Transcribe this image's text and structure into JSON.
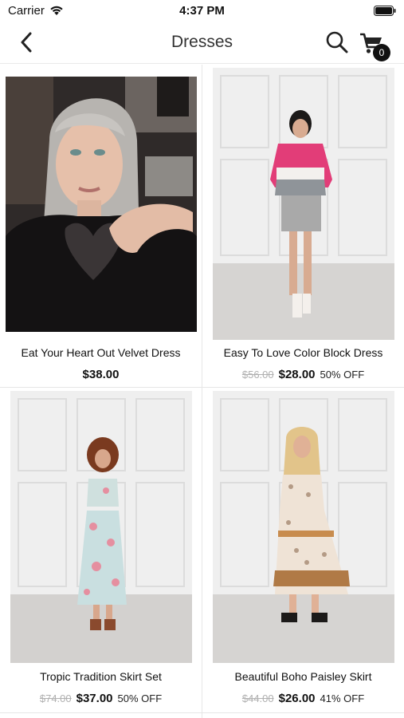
{
  "status": {
    "carrier": "Carrier",
    "time": "4:37 PM"
  },
  "nav": {
    "title": "Dresses",
    "cart_count": "0"
  },
  "products": [
    {
      "title": "Eat Your Heart Out Velvet Dress",
      "price": "$38.00"
    },
    {
      "title": "Easy To Love Color Block Dress",
      "old_price": "$56.00",
      "price": "$28.00",
      "discount": "50% OFF"
    },
    {
      "title": "Tropic Tradition Skirt Set",
      "old_price": "$74.00",
      "price": "$37.00",
      "discount": "50% OFF"
    },
    {
      "title": "Beautiful Boho Paisley Skirt",
      "old_price": "$44.00",
      "price": "$26.00",
      "discount": "41% OFF"
    }
  ]
}
